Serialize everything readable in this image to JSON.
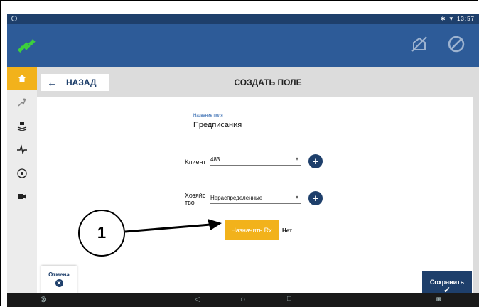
{
  "statusbar": {
    "time": "13:57",
    "icons": "✱ ▼"
  },
  "header": {
    "back_label": "НАЗАД",
    "title": "СОЗДАТЬ ПОЛЕ"
  },
  "form": {
    "name_label": "Название поля",
    "name_value": "Предписания",
    "client_label": "Клиент",
    "client_value": "483",
    "farm_label_line1": "Хозяйс",
    "farm_label_line2": "тво",
    "farm_value": "Нераспределенные",
    "rx_button": "Назначить Rx",
    "rx_value": "Нет"
  },
  "actions": {
    "cancel_label": "Отмена",
    "save_label": "Сохранить"
  },
  "callout": {
    "number": "1"
  },
  "colors": {
    "appbar": "#2d5b98",
    "accent": "#f2b21b",
    "navy": "#1e3f6b"
  },
  "icons": {
    "appbar": [
      "satellite-icon",
      "no-field-icon",
      "steering-off-icon"
    ],
    "leftnav": [
      "home-icon",
      "guidance-icon",
      "layers-icon",
      "pulse-icon",
      "steering-icon",
      "camera-icon"
    ],
    "navbar": [
      "steering-wheel-icon",
      "back-icon",
      "home-icon",
      "recent-apps-icon",
      "camera-icon"
    ]
  }
}
